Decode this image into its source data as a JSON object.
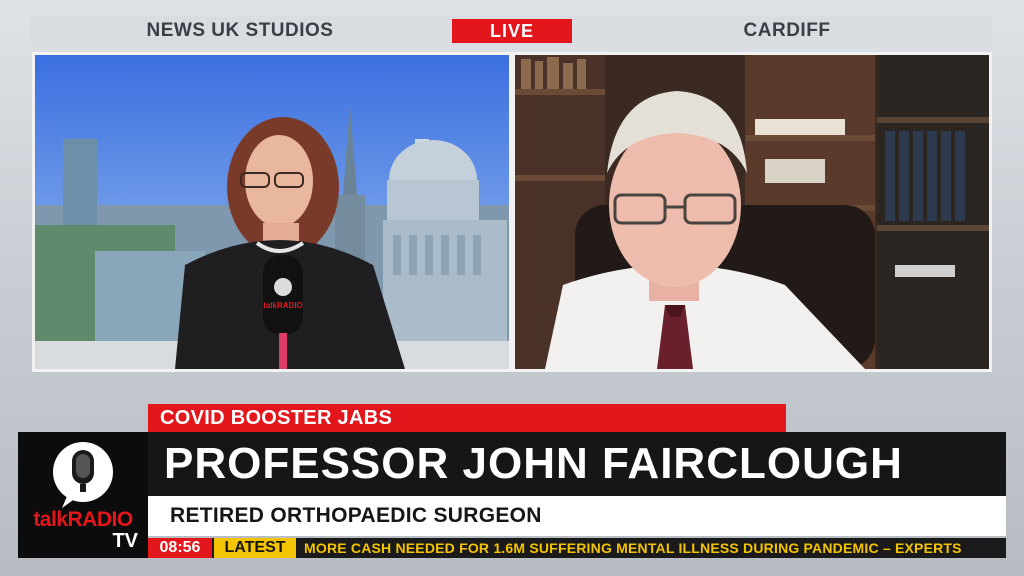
{
  "top_bar": {
    "left_location": "NEWS UK STUDIOS",
    "live_badge": "LIVE",
    "right_location": "CARDIFF"
  },
  "lower_third": {
    "topic": "COVID BOOSTER JABS",
    "name": "PROFESSOR JOHN FAIRCLOUGH",
    "title": "RETIRED ORTHOPAEDIC SURGEON"
  },
  "logo": {
    "talk": "talkRADIO",
    "tv": "TV",
    "mic_badge": "talkRADIO"
  },
  "ticker": {
    "time": "08:56",
    "label": "LATEST",
    "headline": "MORE CASH NEEDED FOR 1.6M SUFFERING MENTAL ILLNESS DURING PANDEMIC – EXPERTS"
  },
  "colors": {
    "brand_red": "#e3161c",
    "ticker_yellow": "#f5c400",
    "name_bar": "#161616"
  }
}
